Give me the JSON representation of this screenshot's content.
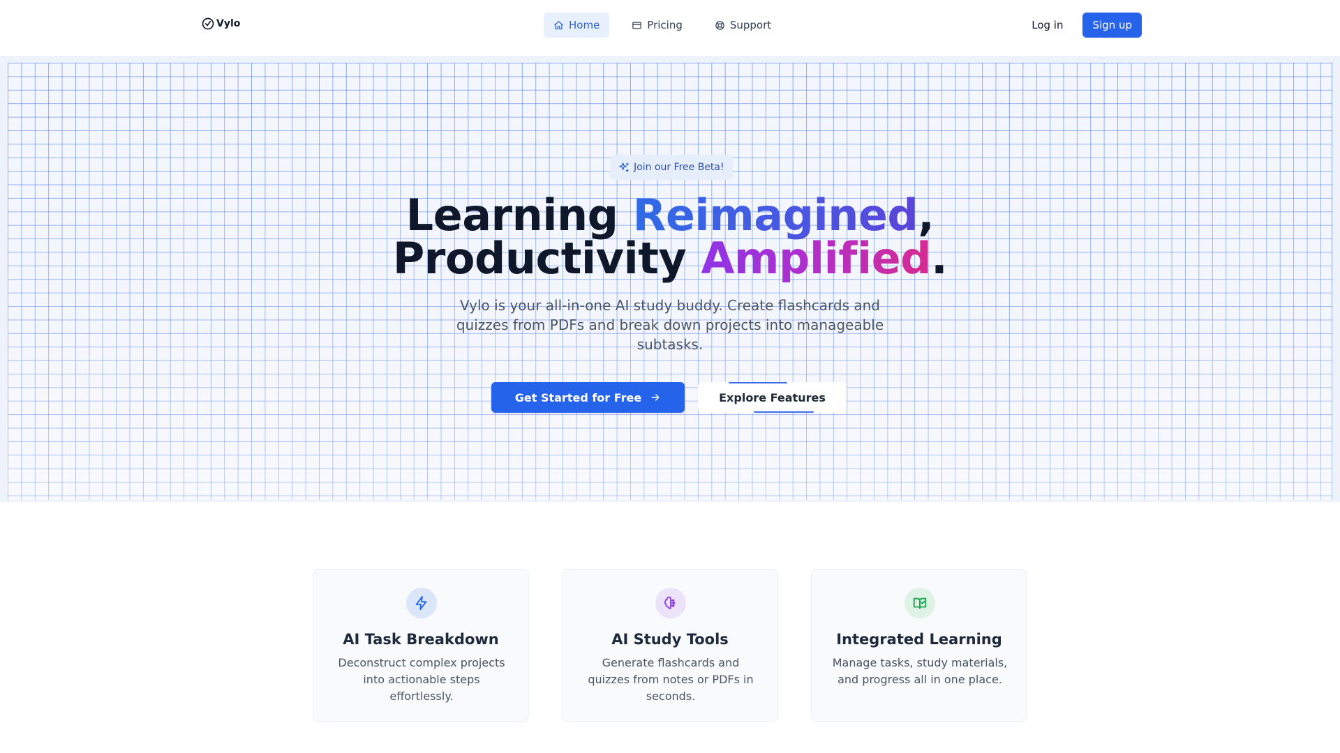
{
  "nav": {
    "logo_text": "Vylo",
    "links": [
      {
        "label": "Home",
        "icon": "home-icon",
        "active": true
      },
      {
        "label": "Pricing",
        "icon": "credit-card-icon",
        "active": false
      },
      {
        "label": "Support",
        "icon": "lifebuoy-icon",
        "active": false
      }
    ],
    "login_label": "Log in",
    "signup_label": "Sign up"
  },
  "hero": {
    "badge": "Join our Free Beta!",
    "headline": {
      "line1_plain": "Learning ",
      "line1_accent": "Reimagined",
      "line1_end": ",",
      "line2_plain": "Productivity ",
      "line2_accent": "Amplified",
      "line2_end": "."
    },
    "subtitle": "Vylo is your all-in-one AI study buddy. Create flashcards and quizzes from PDFs and break down projects into manageable subtasks.",
    "cta_primary": "Get Started for Free",
    "cta_secondary": "Explore Features"
  },
  "features": [
    {
      "icon": "lightning-icon",
      "title": "AI Task Breakdown",
      "desc": "Deconstruct complex projects into actionable steps effortlessly."
    },
    {
      "icon": "brain-icon",
      "title": "AI Study Tools",
      "desc": "Generate flashcards and quizzes from notes or PDFs in seconds."
    },
    {
      "icon": "book-check-icon",
      "title": "Integrated Learning",
      "desc": "Manage tasks, study materials, and progress all in one place."
    }
  ],
  "colors": {
    "primary": "#2563eb",
    "accent_blue": "#2f6be6",
    "accent_purple": "#8f34e6",
    "accent_pink": "#d62a8f",
    "text_dark": "#0f172a"
  }
}
